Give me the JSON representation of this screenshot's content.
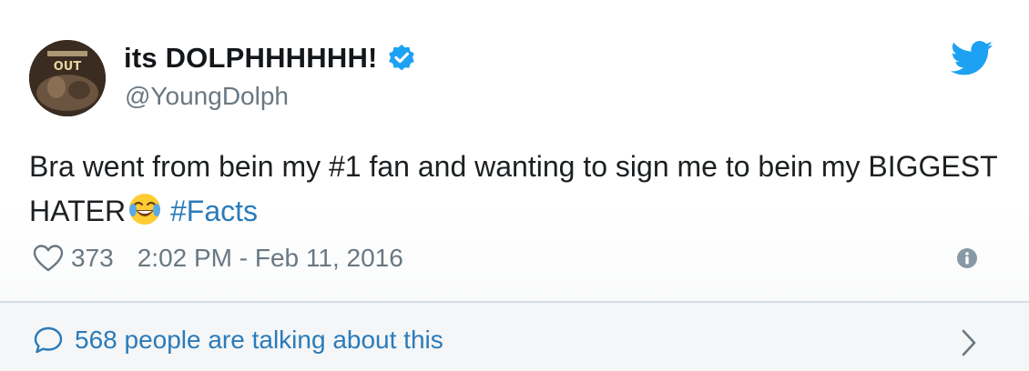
{
  "author": {
    "display_name": "its DOLPHHHHHH!",
    "handle": "@YoungDolph",
    "verified": true,
    "avatar_text": "OUT"
  },
  "tweet": {
    "text_part1": "Bra went from bein my #1 fan and wanting to sign me to bein my BIGGEST HATER",
    "emoji": "face-with-tears-of-joy",
    "hashtag": "#Facts"
  },
  "meta": {
    "like_count": "373",
    "timestamp": "2:02 PM - Feb 11, 2016"
  },
  "footer": {
    "talking_text": "568 people are talking about this"
  },
  "icons": {
    "logo": "twitter-bird-icon",
    "verified": "verified-badge-icon",
    "like": "heart-icon",
    "info": "info-icon",
    "reply": "speech-bubble-icon",
    "more": "chevron-right-icon"
  },
  "colors": {
    "brand_blue": "#1da1f2",
    "link_blue": "#2b7bb9",
    "secondary_text": "#697882",
    "primary_text": "#1c2022"
  }
}
